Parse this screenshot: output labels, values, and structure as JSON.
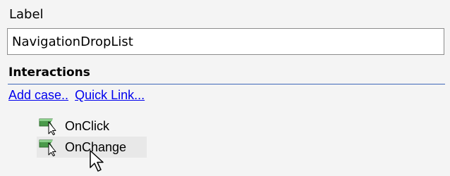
{
  "label_field": {
    "label": "Label",
    "value": "NavigationDropList"
  },
  "interactions": {
    "title": "Interactions",
    "links": {
      "add_case": "Add case..",
      "quick_link": "Quick Link..."
    },
    "events": [
      {
        "name": "OnClick",
        "icon": "interaction-cursor-icon"
      },
      {
        "name": "OnChange",
        "icon": "interaction-cursor-icon"
      }
    ]
  },
  "colors": {
    "background": "#f4f4f4",
    "link": "#0000ee",
    "section_rule": "#3e66b8",
    "hover_row": "#e8e8e8",
    "icon_green": "#4a9a4a"
  }
}
